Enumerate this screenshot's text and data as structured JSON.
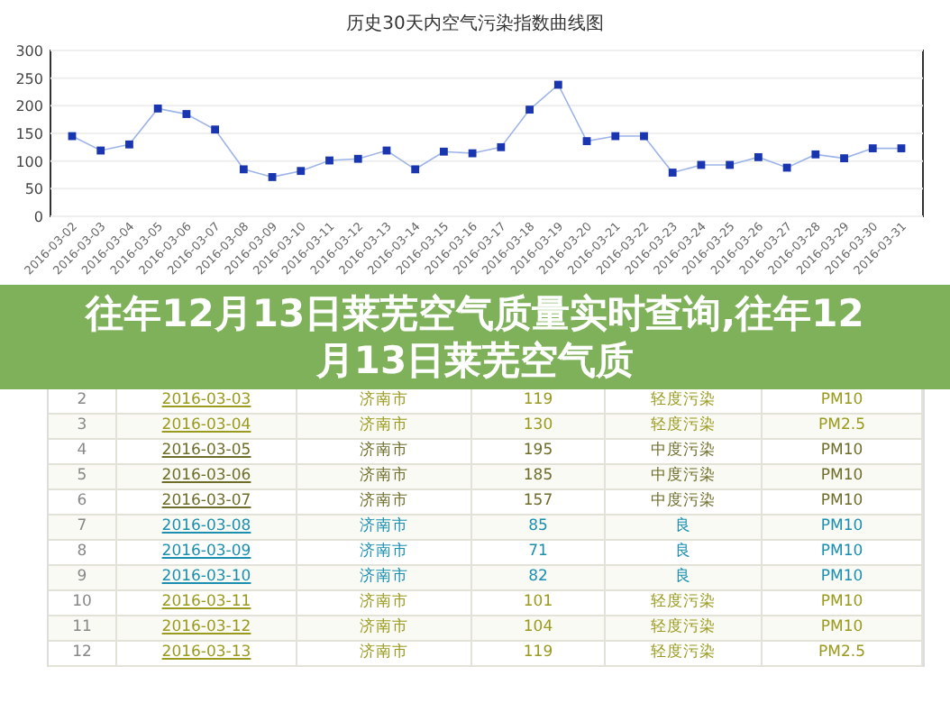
{
  "chart": {
    "chart_data": {
      "type": "line",
      "title": "历史30天内空气污染指数曲线图",
      "categories": [
        "2016-03-02",
        "2016-03-03",
        "2016-03-04",
        "2016-03-05",
        "2016-03-06",
        "2016-03-07",
        "2016-03-08",
        "2016-03-09",
        "2016-03-10",
        "2016-03-11",
        "2016-03-12",
        "2016-03-13",
        "2016-03-14",
        "2016-03-15",
        "2016-03-16",
        "2016-03-17",
        "2016-03-18",
        "2016-03-19",
        "2016-03-20",
        "2016-03-21",
        "2016-03-22",
        "2016-03-23",
        "2016-03-24",
        "2016-03-25",
        "2016-03-26",
        "2016-03-27",
        "2016-03-28",
        "2016-03-29",
        "2016-03-30",
        "2016-03-31"
      ],
      "grid": true,
      "series": [
        {
          "color": "#1a35b0",
          "marker": "square",
          "values": [
            145,
            119,
            130,
            195,
            185,
            157,
            85,
            71,
            82,
            101,
            104,
            119,
            85,
            117,
            114,
            125,
            193,
            238,
            136,
            145,
            145,
            79,
            93,
            93,
            107,
            88,
            112,
            105,
            123,
            123
          ]
        }
      ],
      "ylim": [
        0,
        300
      ],
      "yticks": [
        0,
        50,
        100,
        150,
        200,
        250,
        {
          "value": 300,
          "label": "300"
        }
      ]
    }
  },
  "banner": {
    "title": "往年12月13日莱芜空气质量实时查询,往年12月13日莱芜空气质"
  },
  "table": {
    "rows": [
      {
        "index": "2",
        "date": "2016-03-03",
        "city": "济南市",
        "aqi": "119",
        "level": "轻度污染",
        "pollutant": "PM10",
        "color": "#9a9a1e"
      },
      {
        "index": "3",
        "date": "2016-03-04",
        "city": "济南市",
        "aqi": "130",
        "level": "轻度污染",
        "pollutant": "PM2.5",
        "color": "#9a9a1e"
      },
      {
        "index": "4",
        "date": "2016-03-05",
        "city": "济南市",
        "aqi": "195",
        "level": "中度污染",
        "pollutant": "PM10",
        "color": "#6e6e2a"
      },
      {
        "index": "5",
        "date": "2016-03-06",
        "city": "济南市",
        "aqi": "185",
        "level": "中度污染",
        "pollutant": "PM10",
        "color": "#6e6e2a"
      },
      {
        "index": "6",
        "date": "2016-03-07",
        "city": "济南市",
        "aqi": "157",
        "level": "中度污染",
        "pollutant": "PM10",
        "color": "#6e6e2a"
      },
      {
        "index": "7",
        "date": "2016-03-08",
        "city": "济南市",
        "aqi": "85",
        "level": "良",
        "pollutant": "PM10",
        "color": "#1a8fb0"
      },
      {
        "index": "8",
        "date": "2016-03-09",
        "city": "济南市",
        "aqi": "71",
        "level": "良",
        "pollutant": "PM10",
        "color": "#1a8fb0"
      },
      {
        "index": "9",
        "date": "2016-03-10",
        "city": "济南市",
        "aqi": "82",
        "level": "良",
        "pollutant": "PM10",
        "color": "#1a8fb0"
      },
      {
        "index": "10",
        "date": "2016-03-11",
        "city": "济南市",
        "aqi": "101",
        "level": "轻度污染",
        "pollutant": "PM10",
        "color": "#9a9a1e"
      },
      {
        "index": "11",
        "date": "2016-03-12",
        "city": "济南市",
        "aqi": "104",
        "level": "轻度污染",
        "pollutant": "PM10",
        "color": "#9a9a1e"
      },
      {
        "index": "12",
        "date": "2016-03-13",
        "city": "济南市",
        "aqi": "119",
        "level": "轻度污染",
        "pollutant": "PM2.5",
        "color": "#9a9a1e"
      }
    ]
  }
}
